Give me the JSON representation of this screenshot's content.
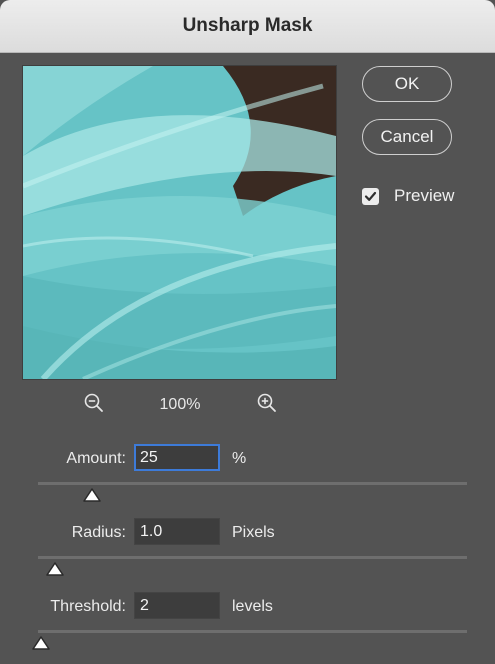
{
  "dialog": {
    "title": "Unsharp Mask"
  },
  "buttons": {
    "ok_label": "OK",
    "cancel_label": "Cancel"
  },
  "preview_toggle": {
    "label": "Preview",
    "checked": true
  },
  "zoom": {
    "level": "100%"
  },
  "controls": {
    "amount": {
      "label": "Amount:",
      "value": "25",
      "unit": "%",
      "slider_fraction": 0.125
    },
    "radius": {
      "label": "Radius:",
      "value": "1.0",
      "unit": "Pixels",
      "slider_fraction": 0.04
    },
    "threshold": {
      "label": "Threshold:",
      "value": "2",
      "unit": "levels",
      "slider_fraction": 0.008
    }
  },
  "colors": {
    "panel": "#535353",
    "accent": "#3d7bd9",
    "fabric": "#6cc6c8"
  },
  "icons": {
    "zoom_out": "magnifier-minus-icon",
    "zoom_in": "magnifier-plus-icon"
  }
}
